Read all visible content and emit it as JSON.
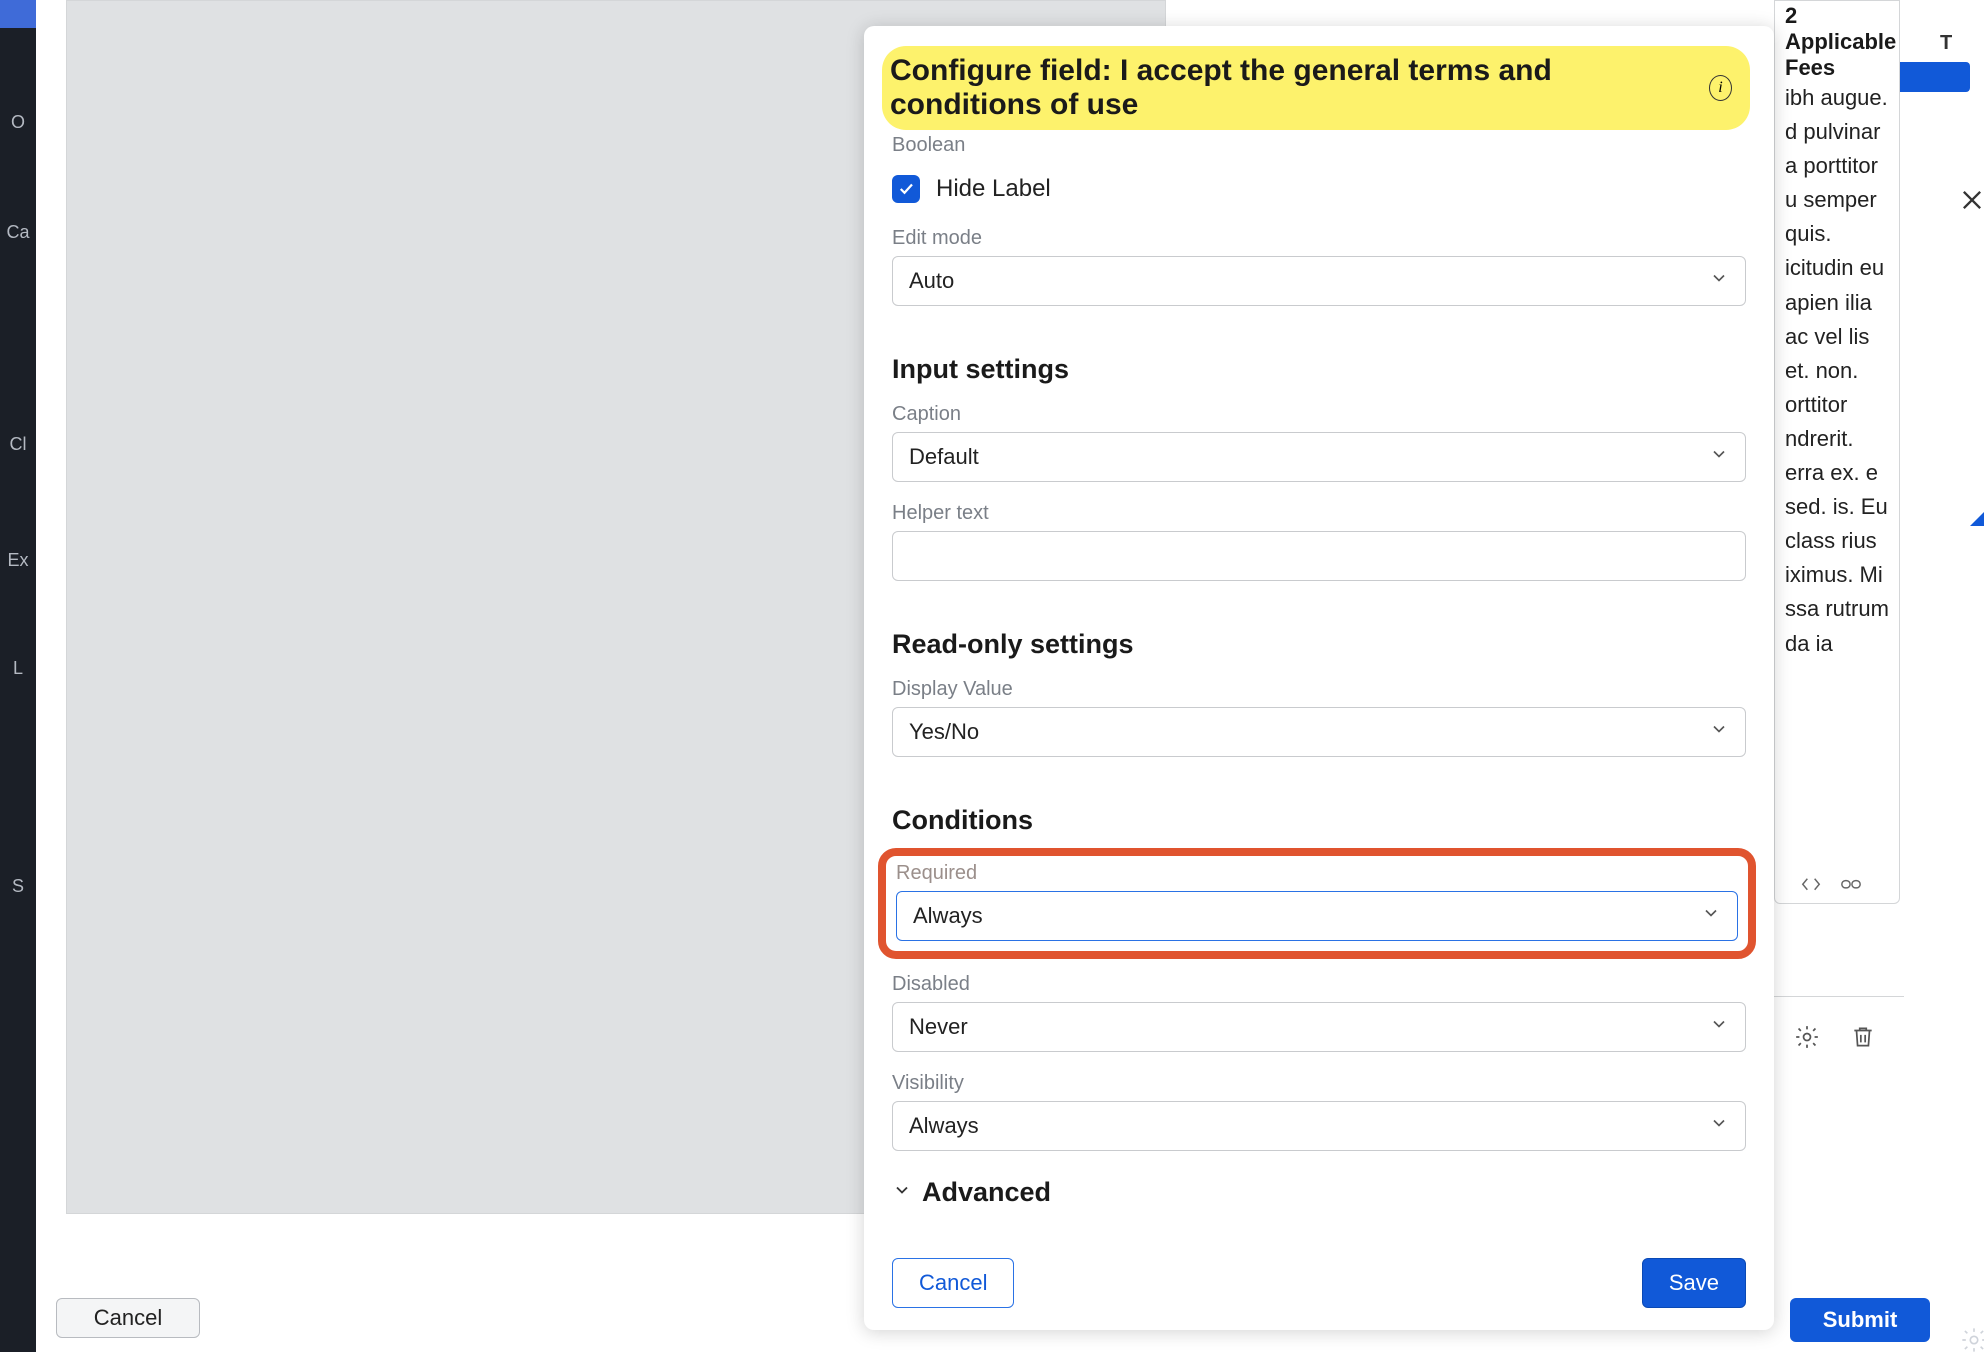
{
  "left_rail": {
    "items": [
      "O",
      "Ca",
      "Cl",
      "Ex",
      "L",
      "S"
    ]
  },
  "background": {
    "right_card_heading": "2  Applicable Fees",
    "right_card_text": "ibh augue. d pulvinar a porttitor u semper quis. icitudin eu apien ilia ac vel\n\nlis et.\nnon. orttitor ndrerit.\nerra ex.\n\ne sed.\n\nis. Eu class rius iximus. Mi ssa rutrum da ia",
    "top_right_badge": "T"
  },
  "modal": {
    "title": "Configure field: I accept the general terms and conditions of use",
    "subtitle": "Boolean",
    "hide_label": {
      "label": "Hide Label",
      "checked": true
    },
    "edit_mode": {
      "label": "Edit mode",
      "value": "Auto"
    },
    "sections": {
      "input_settings": "Input settings",
      "readonly_settings": "Read-only settings",
      "conditions": "Conditions",
      "advanced": "Advanced"
    },
    "caption": {
      "label": "Caption",
      "value": "Default"
    },
    "helper_text": {
      "label": "Helper text",
      "value": ""
    },
    "display_value": {
      "label": "Display Value",
      "value": "Yes/No"
    },
    "required": {
      "label": "Required",
      "value": "Always"
    },
    "disabled": {
      "label": "Disabled",
      "value": "Never"
    },
    "visibility": {
      "label": "Visibility",
      "value": "Always"
    },
    "footer": {
      "cancel": "Cancel",
      "save": "Save"
    }
  },
  "page_footer": {
    "cancel": "Cancel",
    "submit": "Submit"
  }
}
